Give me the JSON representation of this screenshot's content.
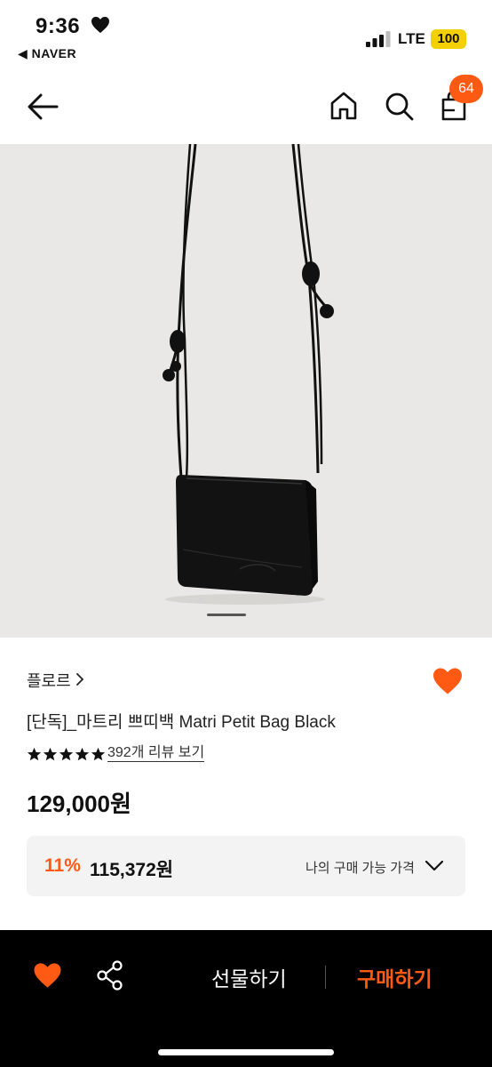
{
  "status_bar": {
    "time": "9:36",
    "back_app": "◀ NAVER",
    "network": "LTE",
    "battery": "100"
  },
  "nav": {
    "cart_count": "64"
  },
  "product": {
    "brand": "플로르",
    "title": "[단독]_마트리 쁘띠백 Matri Petit Bag Black",
    "rating_stars": 5,
    "review_link": "392개 리뷰 보기",
    "price": "129,000원",
    "my_price": {
      "discount_rate": "11%",
      "discount_price": "115,372원",
      "label": "나의 구매 가능 가격"
    }
  },
  "bottom_bar": {
    "gift_label": "선물하기",
    "buy_label": "구매하기"
  },
  "colors": {
    "accent": "#ff5a14",
    "image_bg": "#e9e8e6",
    "bottom_bar_bg": "#000000"
  }
}
